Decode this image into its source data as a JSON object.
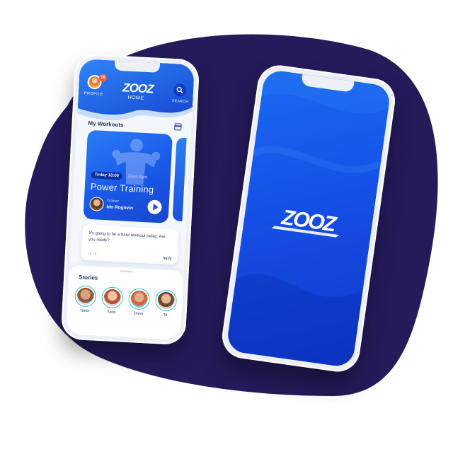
{
  "colors": {
    "blob": "#251a5a",
    "brand_blue": "#1a52dc",
    "dark_blue": "#0c2e9e",
    "story_ring": "#29c9b6",
    "badge": "#ff5a3c"
  },
  "left_phone": {
    "header": {
      "profile_label": "PROFILE",
      "notification_count": "10",
      "logo": "ZOOZ",
      "home_label": "HOME",
      "search_label": "SEARCH",
      "search_icon": "search-icon"
    },
    "workouts": {
      "title": "My Workouts",
      "calendar_icon": "calendar-icon",
      "card": {
        "date": "Today 18:00",
        "gym": "Zeus Gym",
        "title": "Power Training",
        "trainer_label": "Trainer",
        "trainer_name": "Ido Rogovin",
        "play_icon": "play-icon"
      }
    },
    "comment": {
      "text": "It's going to be a hard workout today. Are you ready?",
      "time": "18:15",
      "reply": "reply"
    },
    "stories": {
      "title": "Stories",
      "items": [
        {
          "name": "Tamir"
        },
        {
          "name": "Neta"
        },
        {
          "name": "Dana"
        },
        {
          "name": "Ta"
        }
      ]
    }
  },
  "right_phone": {
    "splash_logo": "ZOOZ"
  }
}
